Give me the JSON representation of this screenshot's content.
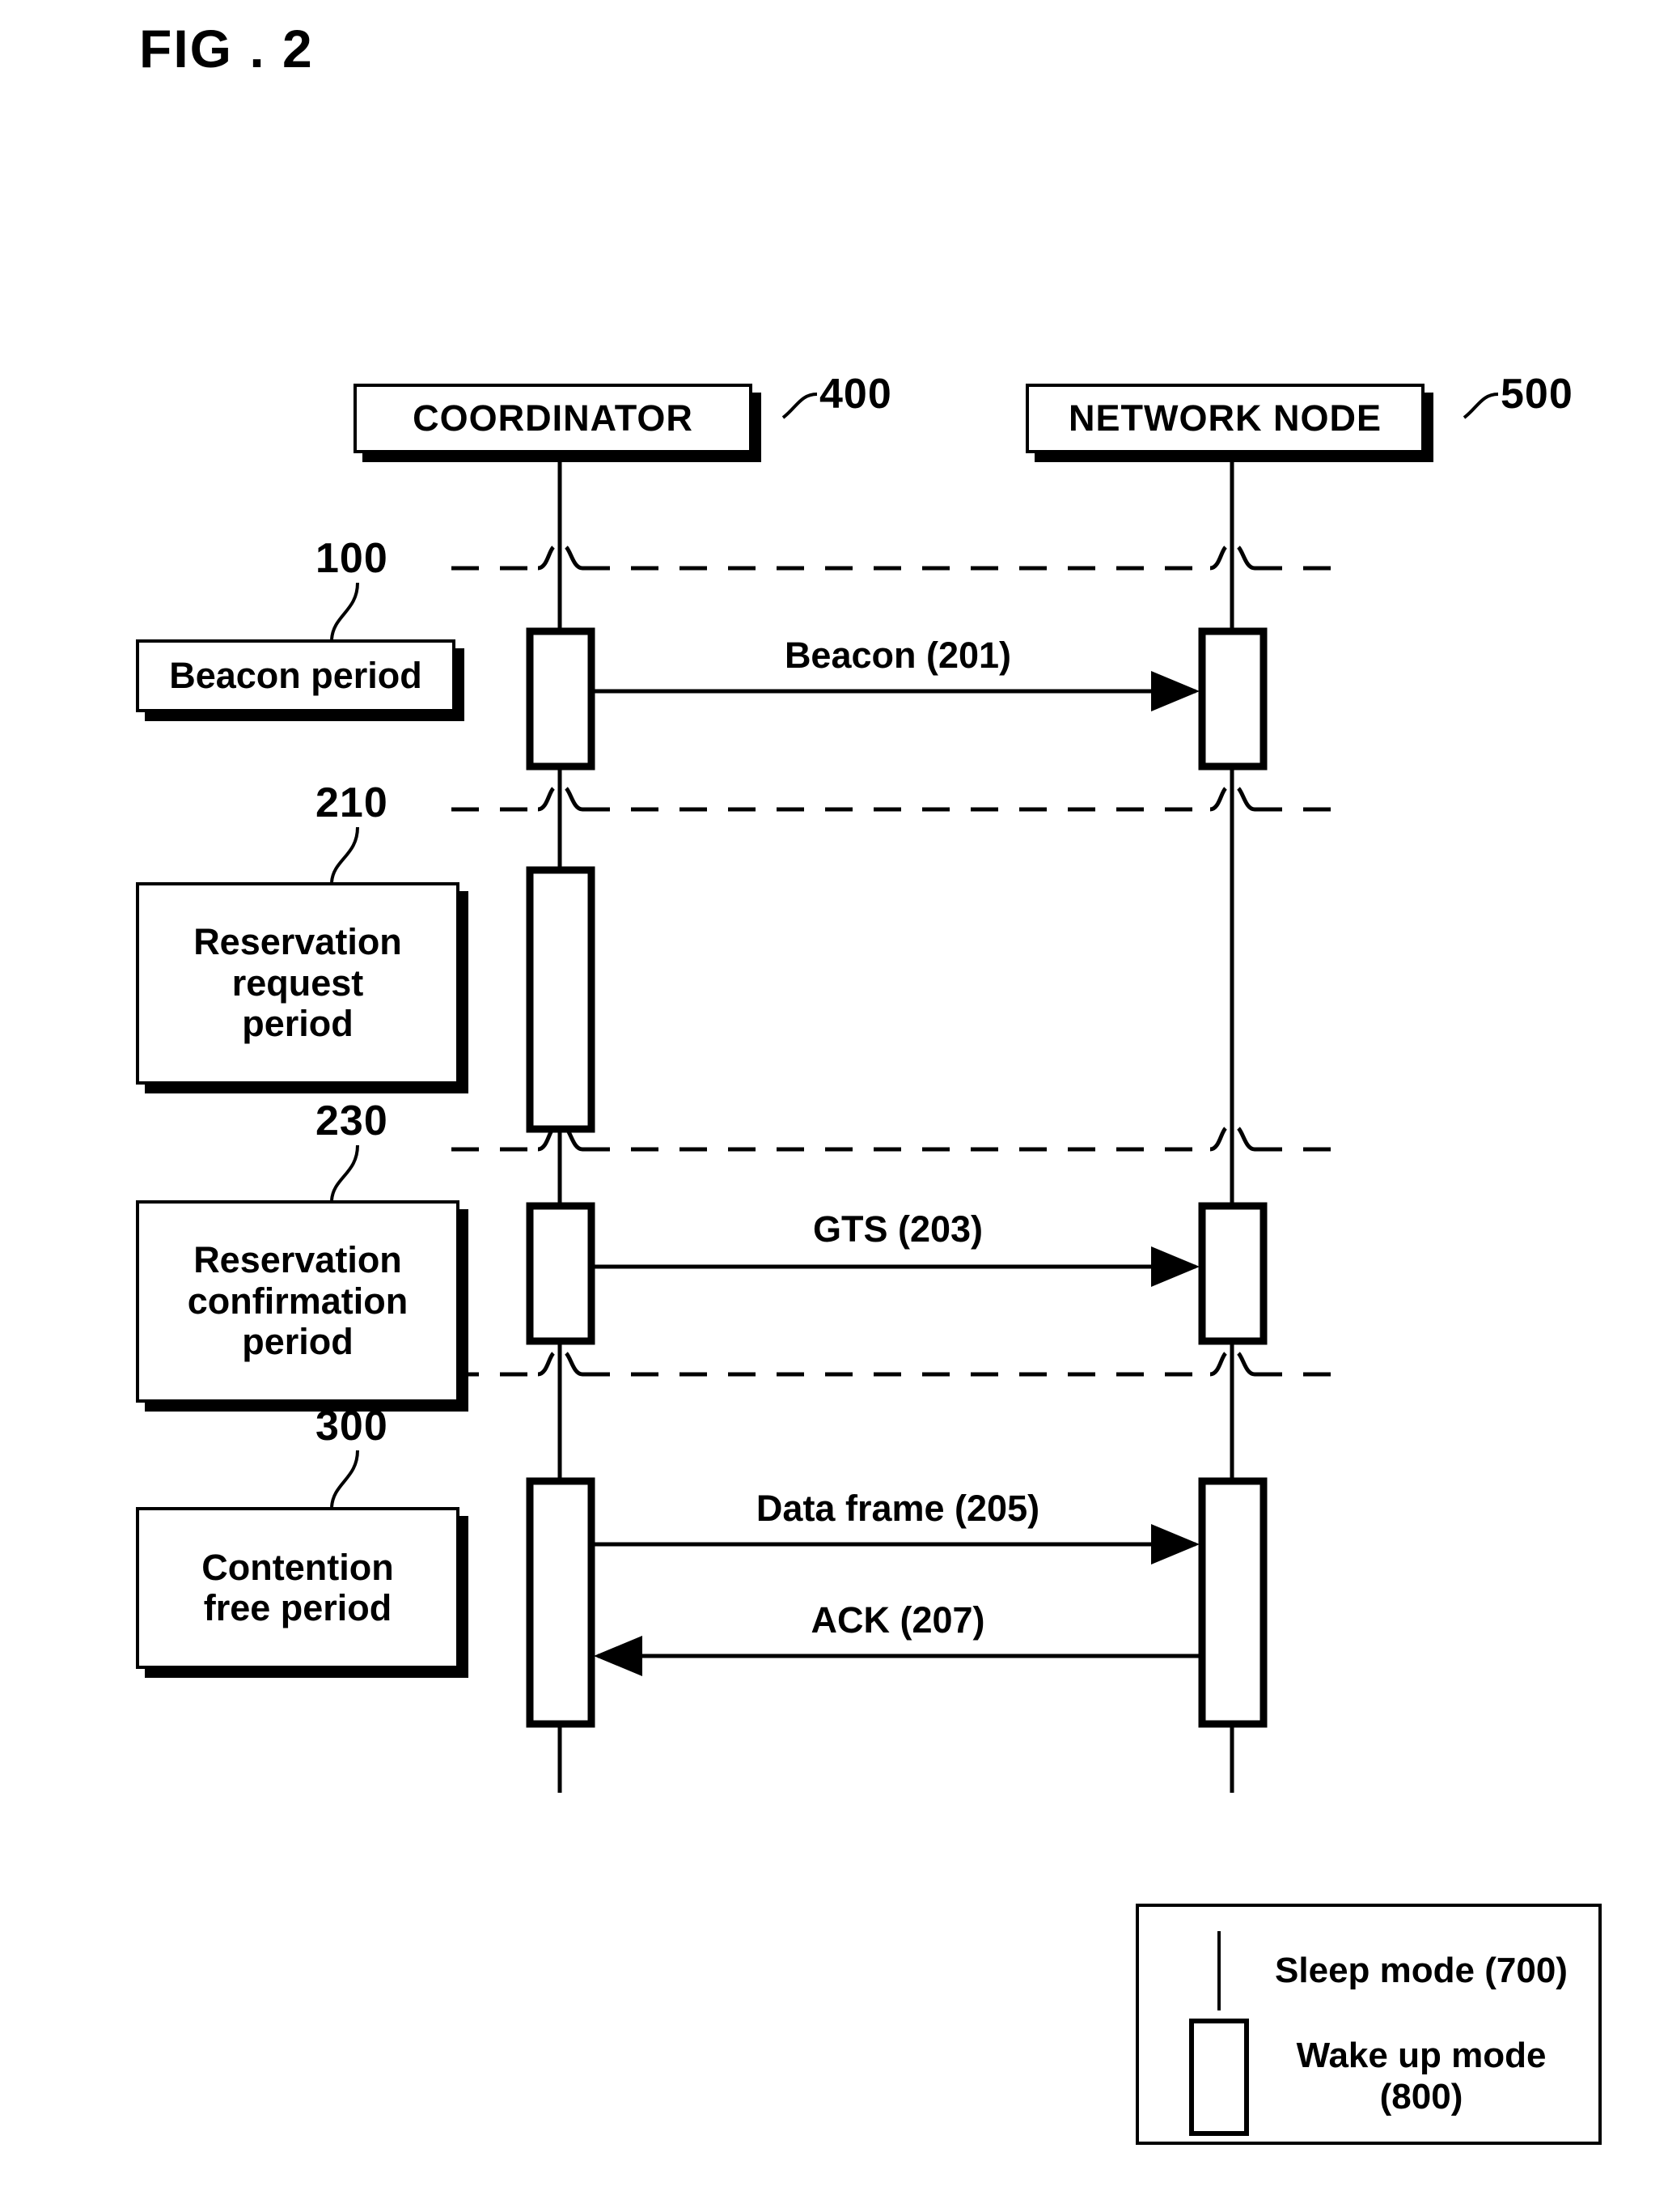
{
  "figure": {
    "title": "FIG . 2"
  },
  "entities": [
    {
      "id": "coordinator",
      "label": "COORDINATOR",
      "ref": "400"
    },
    {
      "id": "network_node",
      "label": "NETWORK NODE",
      "ref": "500"
    }
  ],
  "periods": [
    {
      "id": "beacon",
      "label": "Beacon period",
      "ref": "100"
    },
    {
      "id": "res_request",
      "label": "Reservation\nrequest\nperiod",
      "ref": "210"
    },
    {
      "id": "res_confirm",
      "label": "Reservation\nconfirmation\nperiod",
      "ref": "230"
    },
    {
      "id": "contention_free",
      "label": "Contention\nfree period",
      "ref": "300"
    }
  ],
  "messages": [
    {
      "id": "beacon",
      "label": "Beacon (201)",
      "direction": "right"
    },
    {
      "id": "gts",
      "label": "GTS (203)",
      "direction": "right"
    },
    {
      "id": "data_frame",
      "label": "Data frame (205)",
      "direction": "right"
    },
    {
      "id": "ack",
      "label": "ACK (207)",
      "direction": "left"
    }
  ],
  "legend": {
    "items": [
      {
        "id": "sleep",
        "swatch": "thin-line-icon",
        "label": "Sleep mode (700)"
      },
      {
        "id": "wake_up",
        "swatch": "rectangle-icon",
        "label": "Wake up mode\n(800)"
      }
    ]
  },
  "colors": {
    "ink": "#000000",
    "paper": "#ffffff"
  }
}
